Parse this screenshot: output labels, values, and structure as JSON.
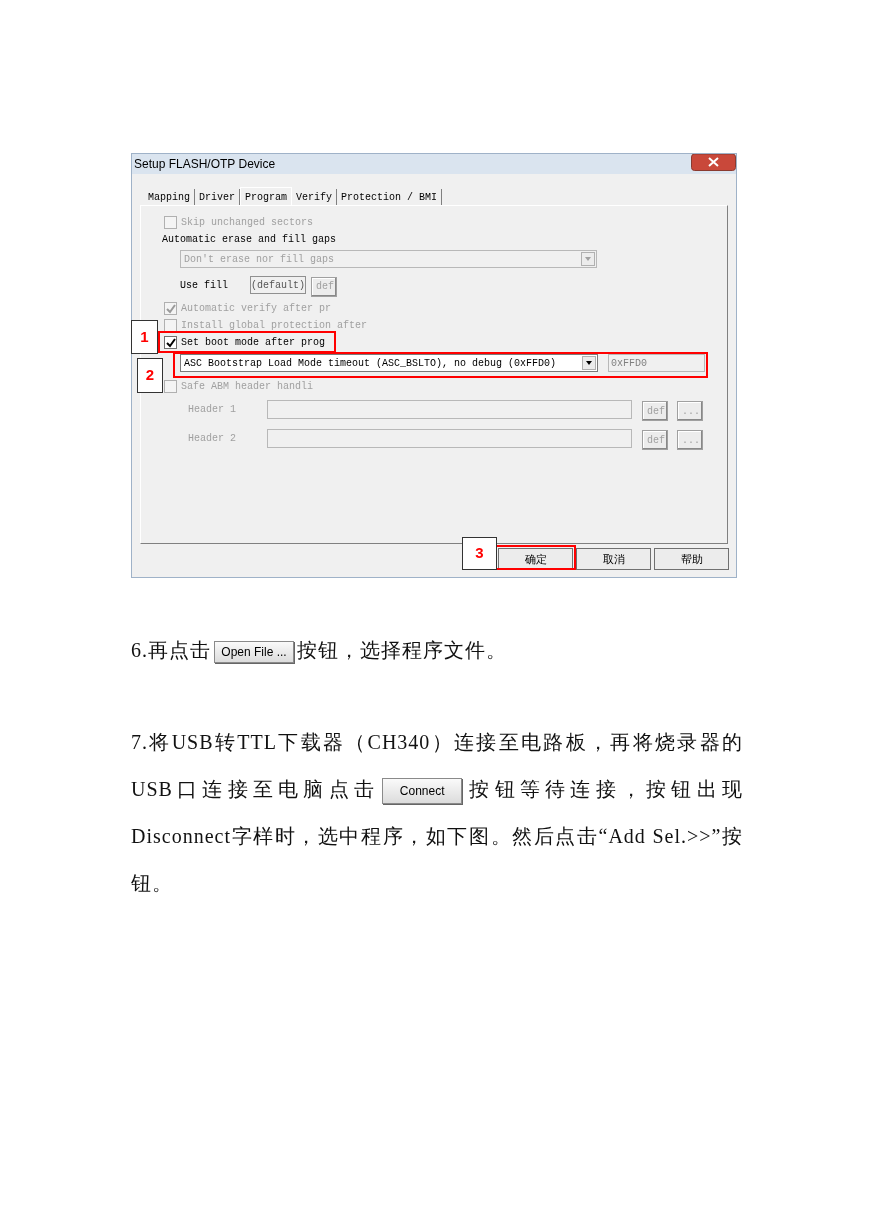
{
  "dialog": {
    "title": "Setup FLASH/OTP Device",
    "tabs": [
      {
        "label": "Mapping",
        "selected": false
      },
      {
        "label": "Driver",
        "selected": false
      },
      {
        "label": "Program",
        "selected": true
      },
      {
        "label": "Verify",
        "selected": false
      },
      {
        "label": "Protection / BMI",
        "selected": false
      }
    ],
    "options": [
      {
        "kind": "checkbox",
        "label": "Skip unchanged sectors",
        "checked": false,
        "disabled": true
      },
      {
        "kind": "heading",
        "label": "Automatic erase and fill gaps"
      },
      {
        "kind": "select",
        "value": "Don't erase nor fill gaps",
        "disabled": true
      },
      {
        "kind": "fill",
        "label": "Use fill",
        "value": "(default)",
        "button": "def"
      },
      {
        "kind": "checkbox",
        "label": "Automatic verify after pr",
        "checked": true,
        "disabled": true
      },
      {
        "kind": "checkbox",
        "label": "Install global protection after",
        "checked": false,
        "disabled": true
      },
      {
        "kind": "checkbox",
        "label": "Set boot mode after prog",
        "checked": true,
        "disabled": false
      },
      {
        "kind": "select_value",
        "value": "ASC Bootstrap Load Mode timeout (ASC_BSLTO), no debug (0xFFD0)",
        "field": "0xFFD0",
        "disabled": false
      },
      {
        "kind": "checkbox",
        "label": "Safe ABM header handli",
        "checked": false,
        "disabled": true
      },
      {
        "kind": "header",
        "label": "Header 1",
        "button": "def",
        "browse": "..."
      },
      {
        "kind": "header",
        "label": "Header 2",
        "button": "def",
        "browse": "..."
      }
    ],
    "buttons": [
      "确定",
      "取消",
      "帮助"
    ]
  },
  "callouts": [
    {
      "number": "1"
    },
    {
      "number": "2"
    },
    {
      "number": "3"
    }
  ],
  "paragraphs": [
    {
      "segments": [
        {
          "kind": "text",
          "text": "6.再点击"
        },
        {
          "kind": "button",
          "text": "Open File ..."
        },
        {
          "kind": "text",
          "text": "按钮，选择程序文件。"
        }
      ]
    },
    {
      "segments": [
        {
          "kind": "text",
          "text": "7.将USB转TTL下载器（CH340）连接至电路板，再将烧录器的USB口连接至电脑点击"
        },
        {
          "kind": "button",
          "text": "Connect"
        },
        {
          "kind": "text",
          "text": "按钮等待连接，按钮出现Disconnect字样时，选中程序，如下图。然后点击“Add Sel.>>”按钮。"
        }
      ]
    }
  ]
}
